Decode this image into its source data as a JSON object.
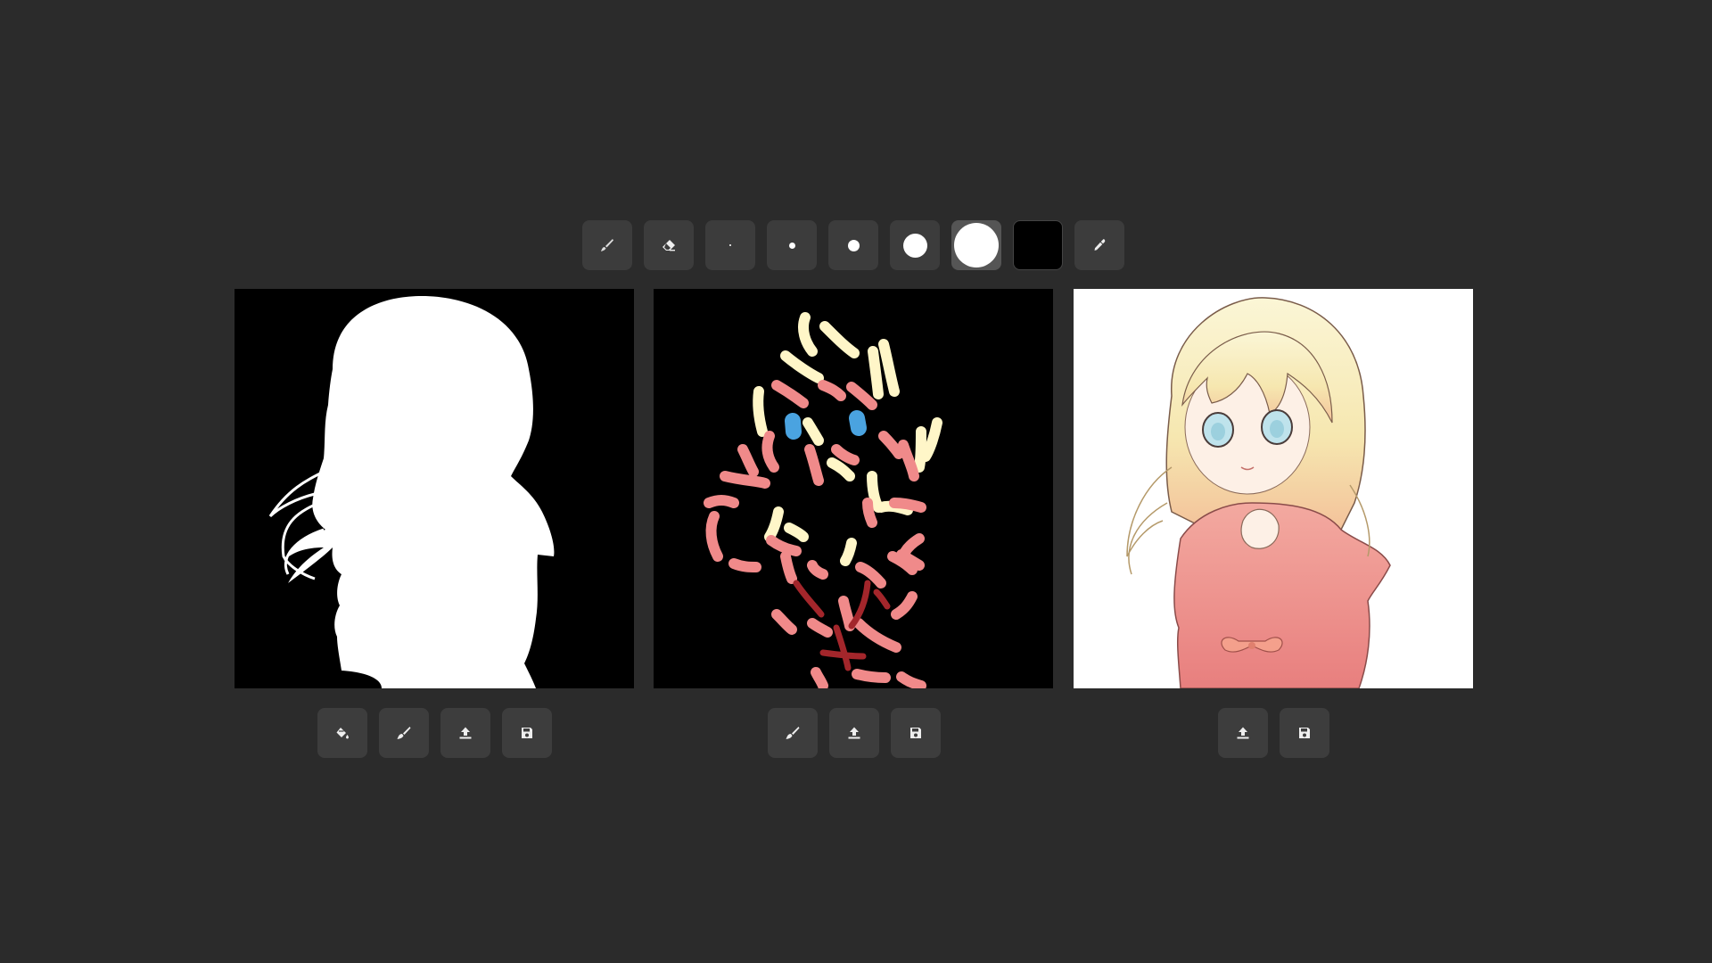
{
  "toolbar": {
    "tools": [
      {
        "name": "brush-tool-button",
        "icon": "paintbrush-icon"
      },
      {
        "name": "eraser-tool-button",
        "icon": "eraser-icon"
      }
    ],
    "brush_sizes": [
      "xs",
      "s",
      "m",
      "l",
      "xl"
    ],
    "selected_brush_size": "xl",
    "selected_color": "#000000",
    "eyedropper_icon": "eyedropper-icon"
  },
  "panels": {
    "mask": {
      "background": "#000000",
      "actions": [
        "paint-bucket-icon",
        "brush-icon",
        "upload-icon",
        "save-icon"
      ]
    },
    "hints": {
      "background": "#000000",
      "actions": [
        "brush-icon",
        "upload-icon",
        "save-icon"
      ]
    },
    "output": {
      "background": "#ffffff",
      "actions": [
        "upload-icon",
        "save-icon"
      ]
    }
  },
  "colors": {
    "app_background": "#2b2b2b",
    "button_background": "#3c3c3c",
    "hint_cream": "#fff6c8",
    "hint_pink": "#f08a8a",
    "hint_blue": "#4aa3e0",
    "hint_darkred": "#a3262b"
  }
}
